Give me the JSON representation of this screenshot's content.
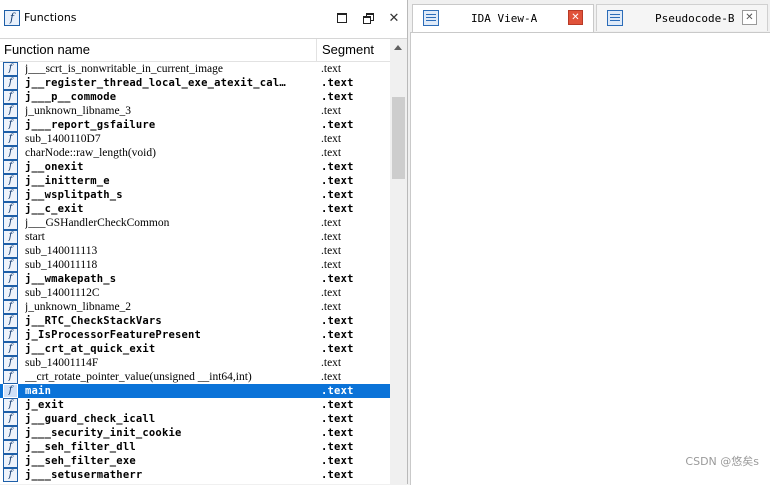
{
  "functions_pane": {
    "title": "Functions",
    "icon": "function-icon",
    "columns": {
      "name": "Function name",
      "segment": "Segment"
    },
    "rows": [
      {
        "name": "j___scrt_is_nonwritable_in_current_image",
        "segment": ".text",
        "bold": false
      },
      {
        "name": "j__register_thread_local_exe_atexit_cal…",
        "segment": ".text",
        "bold": true
      },
      {
        "name": "j___p__commode",
        "segment": ".text",
        "bold": true
      },
      {
        "name": "j_unknown_libname_3",
        "segment": ".text",
        "bold": false
      },
      {
        "name": "j___report_gsfailure",
        "segment": ".text",
        "bold": true
      },
      {
        "name": "sub_1400110D7",
        "segment": ".text",
        "bold": false
      },
      {
        "name": "charNode::raw_length(void)",
        "segment": ".text",
        "bold": false
      },
      {
        "name": "j__onexit",
        "segment": ".text",
        "bold": true
      },
      {
        "name": "j__initterm_e",
        "segment": ".text",
        "bold": true
      },
      {
        "name": "j__wsplitpath_s",
        "segment": ".text",
        "bold": true
      },
      {
        "name": "j__c_exit",
        "segment": ".text",
        "bold": true
      },
      {
        "name": "j___GSHandlerCheckCommon",
        "segment": ".text",
        "bold": false
      },
      {
        "name": "start",
        "segment": ".text",
        "bold": false
      },
      {
        "name": "sub_140011113",
        "segment": ".text",
        "bold": false
      },
      {
        "name": "sub_140011118",
        "segment": ".text",
        "bold": false
      },
      {
        "name": "j__wmakepath_s",
        "segment": ".text",
        "bold": true
      },
      {
        "name": "sub_14001112C",
        "segment": ".text",
        "bold": false
      },
      {
        "name": "j_unknown_libname_2",
        "segment": ".text",
        "bold": false
      },
      {
        "name": "j__RTC_CheckStackVars",
        "segment": ".text",
        "bold": true
      },
      {
        "name": "j_IsProcessorFeaturePresent",
        "segment": ".text",
        "bold": true
      },
      {
        "name": "j__crt_at_quick_exit",
        "segment": ".text",
        "bold": true
      },
      {
        "name": "sub_14001114F",
        "segment": ".text",
        "bold": false
      },
      {
        "name": "__crt_rotate_pointer_value(unsigned __int64,int)",
        "segment": ".text",
        "bold": false
      },
      {
        "name": "main",
        "segment": ".text",
        "bold": true,
        "selected": true
      },
      {
        "name": "j_exit",
        "segment": ".text",
        "bold": true
      },
      {
        "name": "j__guard_check_icall",
        "segment": ".text",
        "bold": true
      },
      {
        "name": "j___security_init_cookie",
        "segment": ".text",
        "bold": true
      },
      {
        "name": "j__seh_filter_dll",
        "segment": ".text",
        "bold": true
      },
      {
        "name": "j__seh_filter_exe",
        "segment": ".text",
        "bold": true
      },
      {
        "name": "j___setusermatherr",
        "segment": ".text",
        "bold": true
      }
    ]
  },
  "tabs": [
    {
      "label": "IDA View-A",
      "active": true,
      "close_color": "#e0523a"
    },
    {
      "label": "Pseudocode-B",
      "active": false
    }
  ],
  "watermark": "CSDN @悠矣s",
  "colors": {
    "selection": "#0b73d8",
    "icon_border": "#1e5fa8"
  }
}
